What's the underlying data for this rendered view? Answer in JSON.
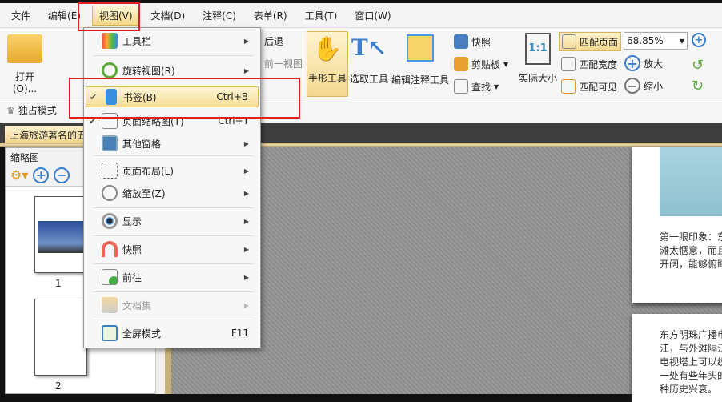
{
  "menubar": {
    "items": [
      "文件",
      "编辑(E)",
      "视图(V)",
      "文档(D)",
      "注释(C)",
      "表单(R)",
      "工具(T)",
      "窗口(W)"
    ]
  },
  "ribbon": {
    "open": "打开(O)...",
    "back": "后退",
    "prev_view": "前一视图",
    "hand_tool": "手形工具",
    "select_tool": "选取工具",
    "edit_annot": "编辑注释工具",
    "snapshot": "快照",
    "clipboard": "剪贴板",
    "find": "查找",
    "actual_size": "实际大小",
    "actual_size_icon": "1:1",
    "fit_page": "匹配页面",
    "fit_width": "匹配宽度",
    "fit_visible": "匹配可见",
    "zoom_value": "68.85%",
    "zoom_in": "放大",
    "zoom_out": "缩小",
    "exclusive_mode": "独占模式"
  },
  "doc_tab": "上海旅游著名的五",
  "thumbnails": {
    "title": "缩略图",
    "pages": [
      "1",
      "2"
    ]
  },
  "view_menu": {
    "items": [
      {
        "label": "工具栏",
        "submenu": true
      },
      {
        "label": "旋转视图(R)",
        "submenu": true
      },
      {
        "label": "书签(B)",
        "shortcut": "Ctrl+B",
        "checked": true
      },
      {
        "label": "页面缩略图(T)",
        "shortcut": "Ctrl+T",
        "checked": true
      },
      {
        "label": "其他窗格",
        "submenu": true
      },
      {
        "label": "页面布局(L)",
        "submenu": true
      },
      {
        "label": "缩放至(Z)",
        "submenu": true
      },
      {
        "label": "显示",
        "submenu": true
      },
      {
        "label": "快照",
        "submenu": true
      },
      {
        "label": "前往",
        "submenu": true
      },
      {
        "label": "文档集",
        "submenu": true,
        "disabled": true
      },
      {
        "label": "全屏模式",
        "shortcut": "F11"
      }
    ]
  },
  "document": {
    "page1_text": [
      "第一眼印象：东",
      "滩太惬意，而且",
      "开阔，能够俯瞰"
    ],
    "page2_text": [
      "东方明珠广播电",
      "江，与外滩隔江",
      "电视塔上可以统",
      "一处有些年头的",
      "种历史兴衰。"
    ]
  },
  "colors": {
    "highlight": "#f6dc91",
    "annotation_red": "#e02020"
  }
}
